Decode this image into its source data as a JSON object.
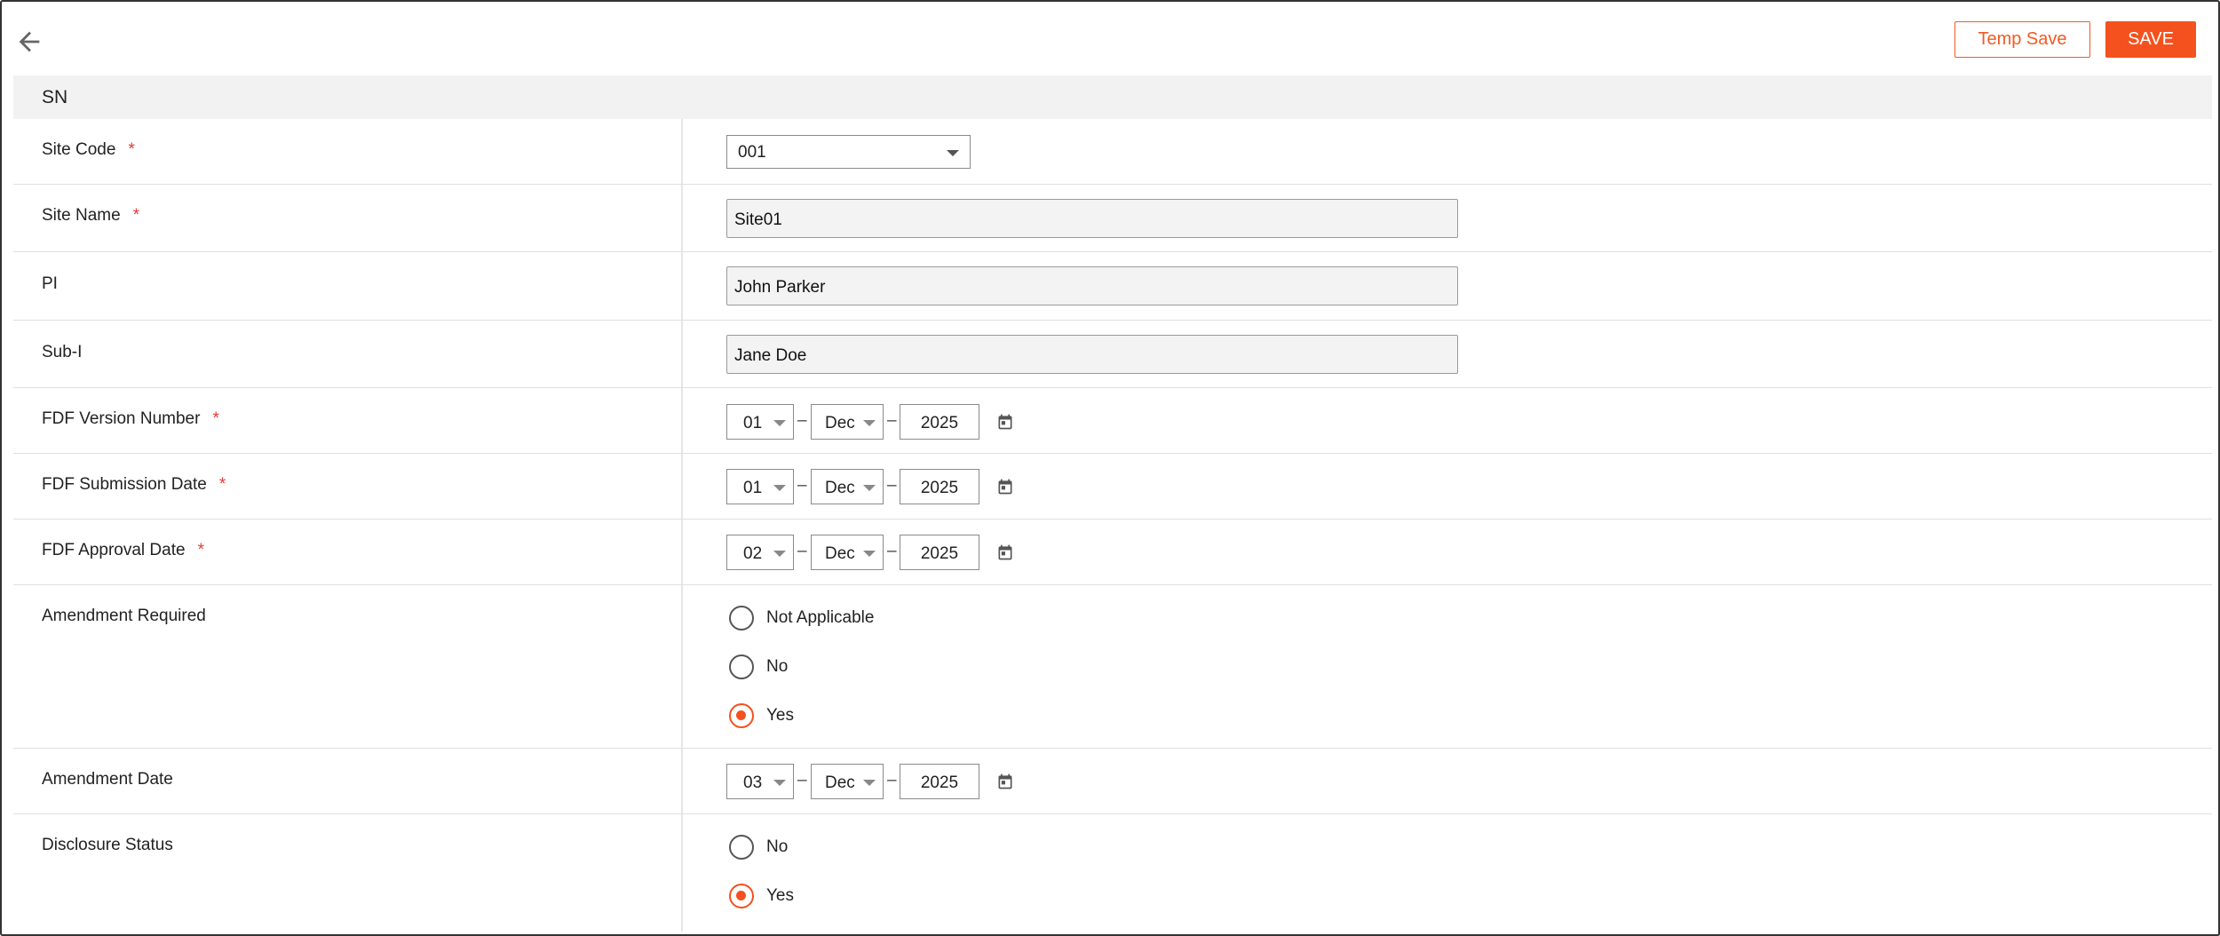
{
  "header": {
    "back_icon": "arrow-left-icon",
    "temp_save_label": "Temp Save",
    "save_label": "SAVE"
  },
  "section": {
    "title": "SN"
  },
  "colors": {
    "accent": "#f4511e",
    "required": "#e53935",
    "header_bg": "#f2f2f2"
  },
  "fields": {
    "site_code": {
      "label": "Site Code",
      "required": "*",
      "value": "001"
    },
    "site_name": {
      "label": "Site Name",
      "required": "*",
      "value": "Site01"
    },
    "pi": {
      "label": "PI",
      "value": "John Parker"
    },
    "sub_i": {
      "label": "Sub-I",
      "value": "Jane Doe"
    },
    "fdf_version": {
      "label": "FDF Version Number",
      "required": "*",
      "day": "01",
      "month": "Dec",
      "year": "2025",
      "sep": "–"
    },
    "fdf_submission": {
      "label": "FDF Submission Date",
      "required": "*",
      "day": "01",
      "month": "Dec",
      "year": "2025",
      "sep": "–"
    },
    "fdf_approval": {
      "label": "FDF Approval Date",
      "required": "*",
      "day": "02",
      "month": "Dec",
      "year": "2025",
      "sep": "–"
    },
    "amendment_required": {
      "label": "Amendment Required",
      "options": [
        {
          "label": "Not Applicable",
          "selected": false
        },
        {
          "label": "No",
          "selected": false
        },
        {
          "label": "Yes",
          "selected": true
        }
      ]
    },
    "amendment_date": {
      "label": "Amendment Date",
      "day": "03",
      "month": "Dec",
      "year": "2025",
      "sep": "–"
    },
    "disclosure_status": {
      "label": "Disclosure Status",
      "options": [
        {
          "label": "No",
          "selected": false
        },
        {
          "label": "Yes",
          "selected": true
        }
      ]
    }
  }
}
